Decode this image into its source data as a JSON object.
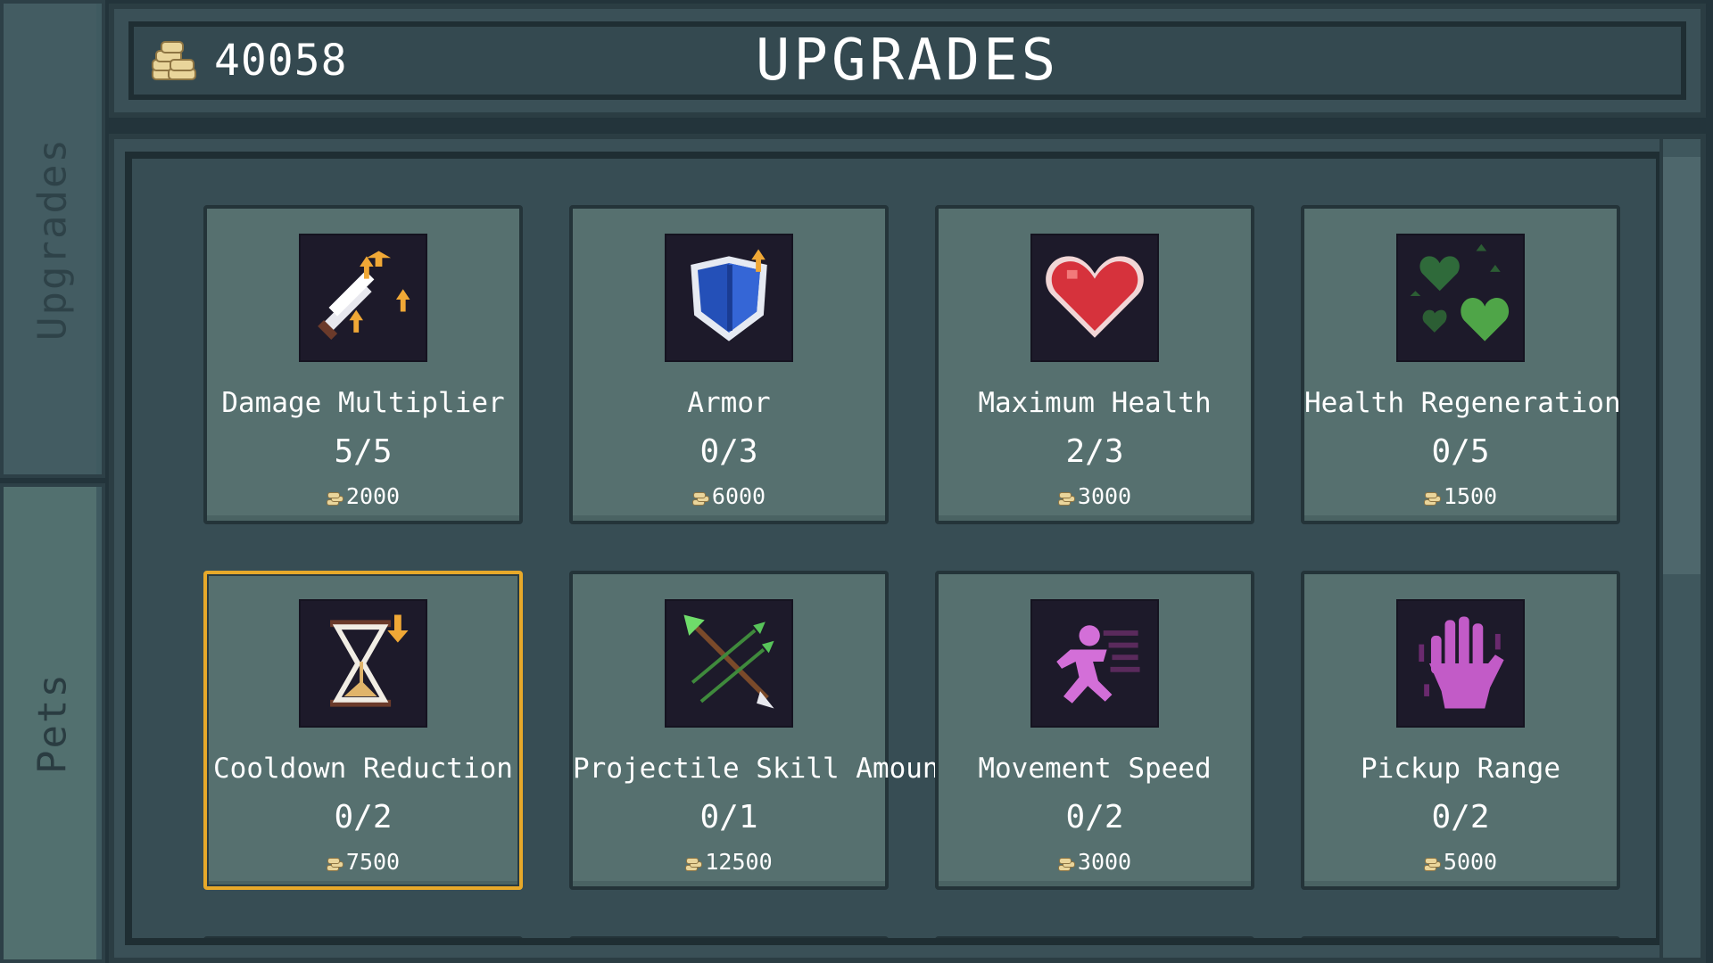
{
  "side_tabs": [
    {
      "label": "Upgrades",
      "active": true
    },
    {
      "label": "Pets",
      "active": false
    }
  ],
  "header": {
    "coin_icon": "coin-stack-icon",
    "coins": "40058",
    "title": "UPGRADES"
  },
  "upgrades": [
    {
      "name": "Damage Multiplier",
      "level": "5/5",
      "cost": "2000",
      "icon": "sword-icon",
      "selected": false
    },
    {
      "name": "Armor",
      "level": "0/3",
      "cost": "6000",
      "icon": "shield-icon",
      "selected": false
    },
    {
      "name": "Maximum Health",
      "level": "2/3",
      "cost": "3000",
      "icon": "heart-icon",
      "selected": false
    },
    {
      "name": "Health Regeneration",
      "level": "0/5",
      "cost": "1500",
      "icon": "regen-hearts-icon",
      "selected": false
    },
    {
      "name": "Cooldown Reduction",
      "level": "0/2",
      "cost": "7500",
      "icon": "hourglass-icon",
      "selected": true
    },
    {
      "name": "Projectile Skill Amount",
      "level": "0/1",
      "cost": "12500",
      "icon": "arrows-icon",
      "selected": false
    },
    {
      "name": "Movement Speed",
      "level": "0/2",
      "cost": "3000",
      "icon": "running-figure-icon",
      "selected": false
    },
    {
      "name": "Pickup Range",
      "level": "0/2",
      "cost": "5000",
      "icon": "hand-icon",
      "selected": false
    }
  ],
  "colors": {
    "selected_border": "#e7a92a",
    "card_bg": "#56706f",
    "icon_bg": "#1d1a2a"
  }
}
